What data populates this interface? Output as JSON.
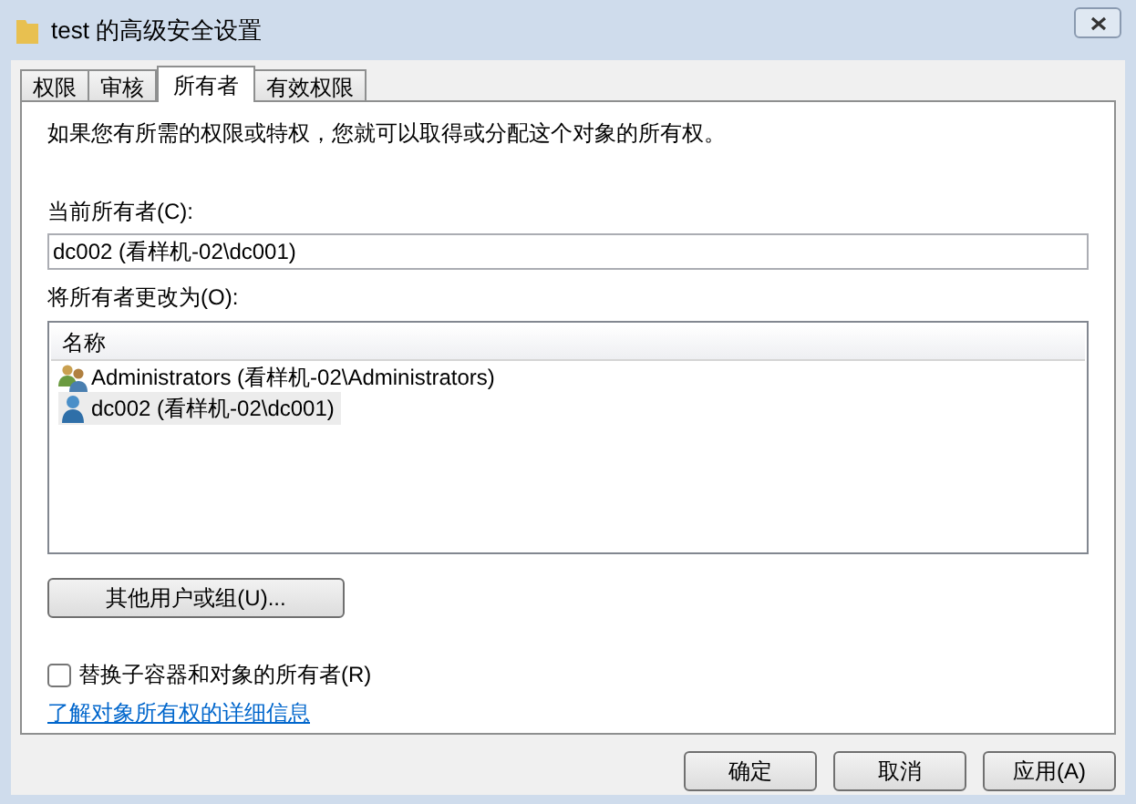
{
  "window": {
    "title": "test 的高级安全设置"
  },
  "tabs": [
    {
      "label": "权限",
      "selected": false
    },
    {
      "label": "审核",
      "selected": false
    },
    {
      "label": "所有者",
      "selected": true
    },
    {
      "label": "有效权限",
      "selected": false
    }
  ],
  "intro": "如果您有所需的权限或特权，您就可以取得或分配这个对象的所有权。",
  "current_owner": {
    "label": "当前所有者(C):",
    "value": "dc002 (看样机-02\\dc001)"
  },
  "change_owner": {
    "label": "将所有者更改为(O):",
    "column": "名称",
    "rows": [
      {
        "kind": "group",
        "name": "Administrators (看样机-02\\Administrators)",
        "selected": false
      },
      {
        "kind": "user",
        "name": "dc002 (看样机-02\\dc001)",
        "selected": true
      }
    ]
  },
  "other_users_button": "其他用户或组(U)...",
  "replace_owner": {
    "label": "替换子容器和对象的所有者(R)",
    "checked": false
  },
  "learn_more_link": "了解对象所有权的详细信息",
  "buttons": [
    "确定",
    "取消",
    "应用(A)"
  ]
}
